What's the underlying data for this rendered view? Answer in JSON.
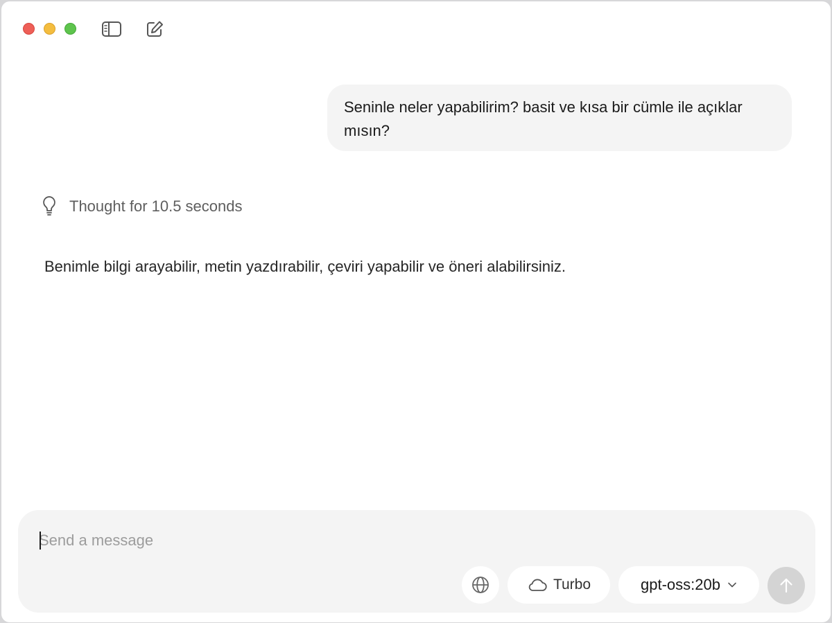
{
  "window": {
    "controls": [
      "close",
      "minimize",
      "zoom"
    ],
    "toolbar_icons": [
      "sidebar-toggle-icon",
      "new-chat-icon"
    ]
  },
  "conversation": {
    "user_message": "Seninle neler yapabilirim? basit ve kısa bir cümle ile açıklar mısın?",
    "thought_label": "Thought for 10.5 seconds",
    "assistant_message": "Benimle bilgi arayabilir, metin yazdırabilir, çeviri yapabilir ve öneri alabilirsiniz."
  },
  "composer": {
    "placeholder": "Send a message",
    "value": "",
    "turbo_label": "Turbo",
    "model_label": "gpt-oss:20b"
  },
  "colors": {
    "close": "#ee5f57",
    "minimize": "#f4bd3f",
    "zoom": "#5ec44d",
    "bubble": "#f4f4f4",
    "send_disabled": "#d4d4d4"
  }
}
